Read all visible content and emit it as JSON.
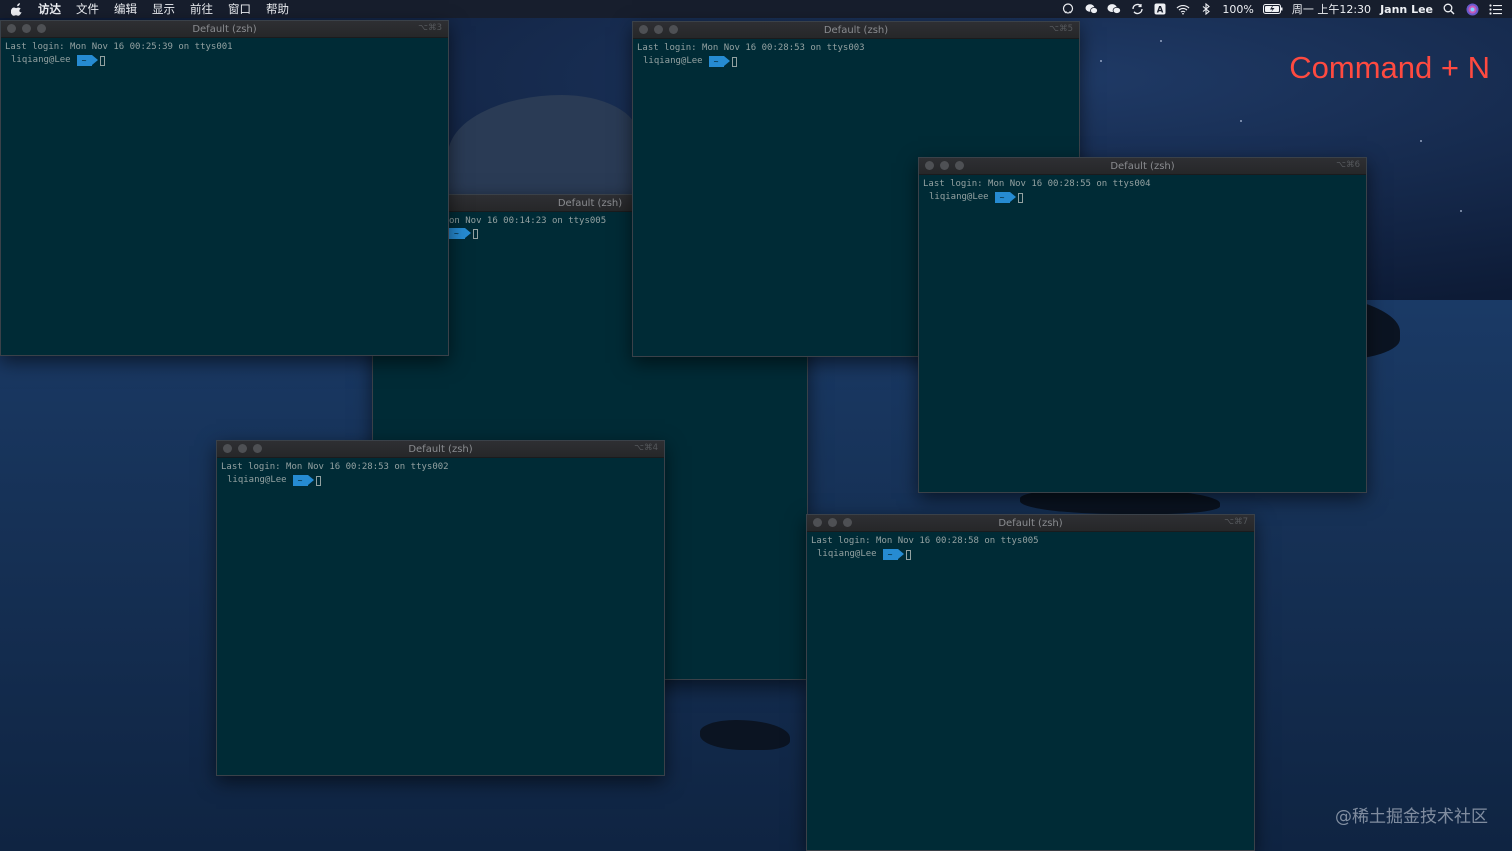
{
  "menubar": {
    "items": [
      "访达",
      "文件",
      "编辑",
      "显示",
      "前往",
      "窗口",
      "帮助"
    ],
    "battery": "100%",
    "datetime": "周一 上午12:30",
    "user": "Jann Lee",
    "icons": [
      "apple-icon",
      "qq-icon",
      "wechat-bubble-icon",
      "wechat-icon",
      "sync-icon",
      "input-method-icon",
      "wifi-icon",
      "bluetooth-icon",
      "battery-icon",
      "search-icon",
      "siri-icon",
      "control-center-icon"
    ]
  },
  "windows": [
    {
      "title": "Default (zsh)",
      "shortcut": "⌥⌘3",
      "login": "Last login: Mon Nov 16 00:25:39 on ttys001",
      "user": "liqiang@Lee",
      "cwd": "~"
    },
    {
      "title": "Default (zsh)",
      "shortcut": "",
      "login": "on Nov 16 00:14:23 on ttys005",
      "user": "",
      "cwd": "~"
    },
    {
      "title": "Default (zsh)",
      "shortcut": "⌥⌘5",
      "login": "Last login: Mon Nov 16 00:28:53 on ttys003",
      "user": "liqiang@Lee",
      "cwd": "~"
    },
    {
      "title": "Default (zsh)",
      "shortcut": "⌥⌘6",
      "login": "Last login: Mon Nov 16 00:28:55 on ttys004",
      "user": "liqiang@Lee",
      "cwd": "~"
    },
    {
      "title": "Default (zsh)",
      "shortcut": "⌥⌘4",
      "login": "Last login: Mon Nov 16 00:28:53 on ttys002",
      "user": "liqiang@Lee",
      "cwd": "~"
    },
    {
      "title": "Default (zsh)",
      "shortcut": "⌥⌘7",
      "login": "Last login: Mon Nov 16 00:28:58 on ttys005",
      "user": "liqiang@Lee",
      "cwd": "~"
    }
  ],
  "overlay": "Command + N",
  "watermark": "@稀土掘金技术社区",
  "colors": {
    "terminal_bg": "#002b36",
    "prompt_accent": "#268bd2",
    "overlay": "#ff4a40"
  }
}
